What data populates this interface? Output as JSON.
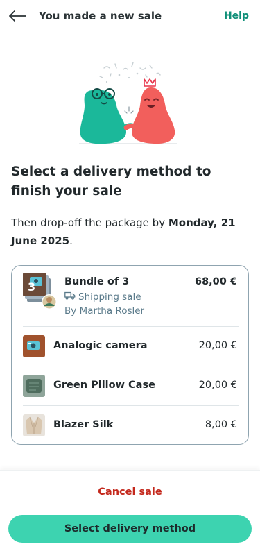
{
  "header": {
    "title": "You made a new sale",
    "help_label": "Help"
  },
  "main": {
    "heading": "Select a delivery method to finish your sale",
    "subtext_prefix": "Then drop-off the package by ",
    "subtext_date": "Monday, 21 June 2025",
    "subtext_suffix": "."
  },
  "bundle": {
    "count": "3",
    "name": "Bundle of 3",
    "shipping_label": "Shipping sale",
    "seller": "By Martha Rosler",
    "price": "68,00 €"
  },
  "items": [
    {
      "name": "Analogic camera",
      "price": "20,00 €",
      "thumb_icon": "camera-photo"
    },
    {
      "name": "Green Pillow Case",
      "price": "20,00 €",
      "thumb_icon": "pillow-photo"
    },
    {
      "name": "Blazer Silk",
      "price": "8,00 €",
      "thumb_icon": "blazer-photo"
    }
  ],
  "footer": {
    "cancel_label": "Cancel sale",
    "primary_label": "Select delivery method"
  },
  "colors": {
    "accent": "#0f8f78",
    "primary_button": "#3dd3b0",
    "danger": "#c4281c",
    "muted": "#5a7a8a"
  }
}
